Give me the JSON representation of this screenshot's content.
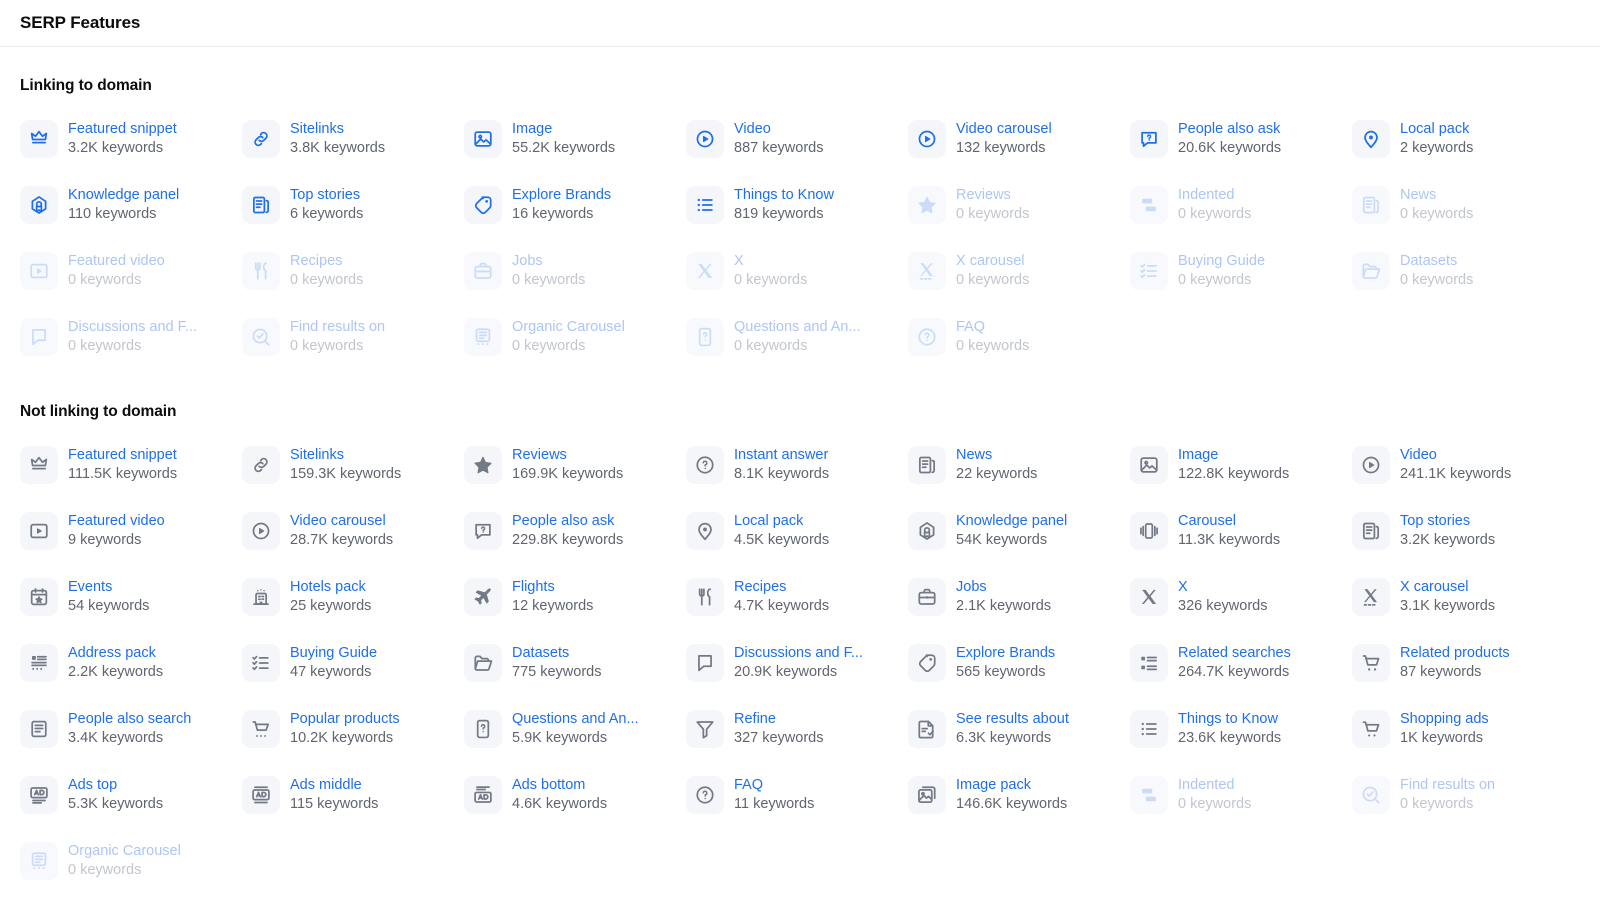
{
  "header": {
    "title": "SERP Features"
  },
  "sections": [
    {
      "id": "linking",
      "heading": "Linking to domain",
      "items": [
        {
          "icon": "featured-snippet-icon",
          "label": "Featured snippet",
          "count": "3.2K keywords",
          "state": "active",
          "tone": "blue"
        },
        {
          "icon": "sitelinks-icon",
          "label": "Sitelinks",
          "count": "3.8K keywords",
          "state": "active",
          "tone": "blue"
        },
        {
          "icon": "image-icon",
          "label": "Image",
          "count": "55.2K keywords",
          "state": "active",
          "tone": "blue"
        },
        {
          "icon": "video-icon",
          "label": "Video",
          "count": "887 keywords",
          "state": "active",
          "tone": "blue"
        },
        {
          "icon": "video-carousel-icon",
          "label": "Video carousel",
          "count": "132 keywords",
          "state": "active",
          "tone": "blue"
        },
        {
          "icon": "people-also-ask-icon",
          "label": "People also ask",
          "count": "20.6K keywords",
          "state": "active",
          "tone": "blue"
        },
        {
          "icon": "local-pack-icon",
          "label": "Local pack",
          "count": "2 keywords",
          "state": "active",
          "tone": "blue"
        },
        {
          "icon": "knowledge-panel-icon",
          "label": "Knowledge panel",
          "count": "110 keywords",
          "state": "active",
          "tone": "blue"
        },
        {
          "icon": "top-stories-icon",
          "label": "Top stories",
          "count": "6 keywords",
          "state": "active",
          "tone": "blue"
        },
        {
          "icon": "explore-brands-icon",
          "label": "Explore Brands",
          "count": "16 keywords",
          "state": "active",
          "tone": "blue"
        },
        {
          "icon": "things-to-know-icon",
          "label": "Things to Know",
          "count": "819 keywords",
          "state": "active",
          "tone": "blue"
        },
        {
          "icon": "reviews-icon",
          "label": "Reviews",
          "count": "0 keywords",
          "state": "disabled",
          "tone": "fade"
        },
        {
          "icon": "indented-icon",
          "label": "Indented",
          "count": "0 keywords",
          "state": "disabled",
          "tone": "fade"
        },
        {
          "icon": "news-icon",
          "label": "News",
          "count": "0 keywords",
          "state": "disabled",
          "tone": "fade"
        },
        {
          "icon": "featured-video-icon",
          "label": "Featured video",
          "count": "0 keywords",
          "state": "disabled",
          "tone": "fade"
        },
        {
          "icon": "recipes-icon",
          "label": "Recipes",
          "count": "0 keywords",
          "state": "disabled",
          "tone": "fade"
        },
        {
          "icon": "jobs-icon",
          "label": "Jobs",
          "count": "0 keywords",
          "state": "disabled",
          "tone": "fade"
        },
        {
          "icon": "x-icon",
          "label": "X",
          "count": "0 keywords",
          "state": "disabled",
          "tone": "fade"
        },
        {
          "icon": "x-carousel-icon",
          "label": "X carousel",
          "count": "0 keywords",
          "state": "disabled",
          "tone": "fade"
        },
        {
          "icon": "buying-guide-icon",
          "label": "Buying Guide",
          "count": "0 keywords",
          "state": "disabled",
          "tone": "fade"
        },
        {
          "icon": "datasets-icon",
          "label": "Datasets",
          "count": "0 keywords",
          "state": "disabled",
          "tone": "fade"
        },
        {
          "icon": "discussions-and-forums-icon",
          "label": "Discussions and F...",
          "count": "0 keywords",
          "state": "disabled",
          "tone": "fade"
        },
        {
          "icon": "find-results-on-icon",
          "label": "Find results on",
          "count": "0 keywords",
          "state": "disabled",
          "tone": "fade"
        },
        {
          "icon": "organic-carousel-icon",
          "label": "Organic Carousel",
          "count": "0 keywords",
          "state": "disabled",
          "tone": "fade"
        },
        {
          "icon": "questions-and-answers-icon",
          "label": "Questions and An...",
          "count": "0 keywords",
          "state": "disabled",
          "tone": "fade"
        },
        {
          "icon": "faq-icon",
          "label": "FAQ",
          "count": "0 keywords",
          "state": "disabled",
          "tone": "fade"
        }
      ]
    },
    {
      "id": "notlinking",
      "heading": "Not linking to domain",
      "items": [
        {
          "icon": "featured-snippet-icon",
          "label": "Featured snippet",
          "count": "111.5K keywords",
          "state": "active",
          "tone": "grey"
        },
        {
          "icon": "sitelinks-icon",
          "label": "Sitelinks",
          "count": "159.3K keywords",
          "state": "active",
          "tone": "grey"
        },
        {
          "icon": "reviews-icon",
          "label": "Reviews",
          "count": "169.9K keywords",
          "state": "active",
          "tone": "grey"
        },
        {
          "icon": "instant-answer-icon",
          "label": "Instant answer",
          "count": "8.1K keywords",
          "state": "active",
          "tone": "grey"
        },
        {
          "icon": "news-icon",
          "label": "News",
          "count": "22 keywords",
          "state": "active",
          "tone": "grey"
        },
        {
          "icon": "image-icon",
          "label": "Image",
          "count": "122.8K keywords",
          "state": "active",
          "tone": "grey"
        },
        {
          "icon": "video-icon",
          "label": "Video",
          "count": "241.1K keywords",
          "state": "active",
          "tone": "grey"
        },
        {
          "icon": "featured-video-icon",
          "label": "Featured video",
          "count": "9 keywords",
          "state": "active",
          "tone": "grey"
        },
        {
          "icon": "video-carousel-icon",
          "label": "Video carousel",
          "count": "28.7K keywords",
          "state": "active",
          "tone": "grey"
        },
        {
          "icon": "people-also-ask-icon",
          "label": "People also ask",
          "count": "229.8K keywords",
          "state": "active",
          "tone": "grey"
        },
        {
          "icon": "local-pack-icon",
          "label": "Local pack",
          "count": "4.5K keywords",
          "state": "active",
          "tone": "grey"
        },
        {
          "icon": "knowledge-panel-icon",
          "label": "Knowledge panel",
          "count": "54K keywords",
          "state": "active",
          "tone": "grey"
        },
        {
          "icon": "carousel-icon",
          "label": "Carousel",
          "count": "11.3K keywords",
          "state": "active",
          "tone": "grey"
        },
        {
          "icon": "top-stories-icon",
          "label": "Top stories",
          "count": "3.2K keywords",
          "state": "active",
          "tone": "grey"
        },
        {
          "icon": "events-icon",
          "label": "Events",
          "count": "54 keywords",
          "state": "active",
          "tone": "grey"
        },
        {
          "icon": "hotels-pack-icon",
          "label": "Hotels pack",
          "count": "25 keywords",
          "state": "active",
          "tone": "grey"
        },
        {
          "icon": "flights-icon",
          "label": "Flights",
          "count": "12 keywords",
          "state": "active",
          "tone": "grey"
        },
        {
          "icon": "recipes-icon",
          "label": "Recipes",
          "count": "4.7K keywords",
          "state": "active",
          "tone": "grey"
        },
        {
          "icon": "jobs-icon",
          "label": "Jobs",
          "count": "2.1K keywords",
          "state": "active",
          "tone": "grey"
        },
        {
          "icon": "x-icon",
          "label": "X",
          "count": "326 keywords",
          "state": "active",
          "tone": "grey"
        },
        {
          "icon": "x-carousel-icon",
          "label": "X carousel",
          "count": "3.1K keywords",
          "state": "active",
          "tone": "grey"
        },
        {
          "icon": "address-pack-icon",
          "label": "Address pack",
          "count": "2.2K keywords",
          "state": "active",
          "tone": "grey"
        },
        {
          "icon": "buying-guide-icon",
          "label": "Buying Guide",
          "count": "47 keywords",
          "state": "active",
          "tone": "grey"
        },
        {
          "icon": "datasets-icon",
          "label": "Datasets",
          "count": "775 keywords",
          "state": "active",
          "tone": "grey"
        },
        {
          "icon": "discussions-and-forums-icon",
          "label": "Discussions and F...",
          "count": "20.9K keywords",
          "state": "active",
          "tone": "grey"
        },
        {
          "icon": "explore-brands-icon",
          "label": "Explore Brands",
          "count": "565 keywords",
          "state": "active",
          "tone": "grey"
        },
        {
          "icon": "related-searches-icon",
          "label": "Related searches",
          "count": "264.7K keywords",
          "state": "active",
          "tone": "grey"
        },
        {
          "icon": "related-products-icon",
          "label": "Related products",
          "count": "87 keywords",
          "state": "active",
          "tone": "grey"
        },
        {
          "icon": "people-also-search-icon",
          "label": "People also search",
          "count": "3.4K keywords",
          "state": "active",
          "tone": "grey"
        },
        {
          "icon": "popular-products-icon",
          "label": "Popular products",
          "count": "10.2K keywords",
          "state": "active",
          "tone": "grey"
        },
        {
          "icon": "questions-and-answers-icon",
          "label": "Questions and An...",
          "count": "5.9K keywords",
          "state": "active",
          "tone": "grey"
        },
        {
          "icon": "refine-icon",
          "label": "Refine",
          "count": "327 keywords",
          "state": "active",
          "tone": "grey"
        },
        {
          "icon": "see-results-about-icon",
          "label": "See results about",
          "count": "6.3K keywords",
          "state": "active",
          "tone": "grey"
        },
        {
          "icon": "things-to-know-icon",
          "label": "Things to Know",
          "count": "23.6K keywords",
          "state": "active",
          "tone": "grey"
        },
        {
          "icon": "shopping-ads-icon",
          "label": "Shopping ads",
          "count": "1K keywords",
          "state": "active",
          "tone": "grey"
        },
        {
          "icon": "ads-top-icon",
          "label": "Ads top",
          "count": "5.3K keywords",
          "state": "active",
          "tone": "grey"
        },
        {
          "icon": "ads-middle-icon",
          "label": "Ads middle",
          "count": "115 keywords",
          "state": "active",
          "tone": "grey"
        },
        {
          "icon": "ads-bottom-icon",
          "label": "Ads bottom",
          "count": "4.6K keywords",
          "state": "active",
          "tone": "grey"
        },
        {
          "icon": "faq-icon",
          "label": "FAQ",
          "count": "11 keywords",
          "state": "active",
          "tone": "grey"
        },
        {
          "icon": "image-pack-icon",
          "label": "Image pack",
          "count": "146.6K keywords",
          "state": "active",
          "tone": "grey"
        },
        {
          "icon": "indented-icon",
          "label": "Indented",
          "count": "0 keywords",
          "state": "disabled",
          "tone": "fadegrey"
        },
        {
          "icon": "find-results-on-icon",
          "label": "Find results on",
          "count": "0 keywords",
          "state": "disabled",
          "tone": "fadegrey"
        },
        {
          "icon": "organic-carousel-icon",
          "label": "Organic Carousel",
          "count": "0 keywords",
          "state": "disabled",
          "tone": "fadegrey"
        }
      ]
    }
  ],
  "colors": {
    "link": "#1f6fea",
    "count": "#60656e",
    "tile_bg": "#f4f6fa",
    "disabled_link": "#aec6f3",
    "disabled_count": "#c2c6cd",
    "divider": "#e8eaee"
  }
}
